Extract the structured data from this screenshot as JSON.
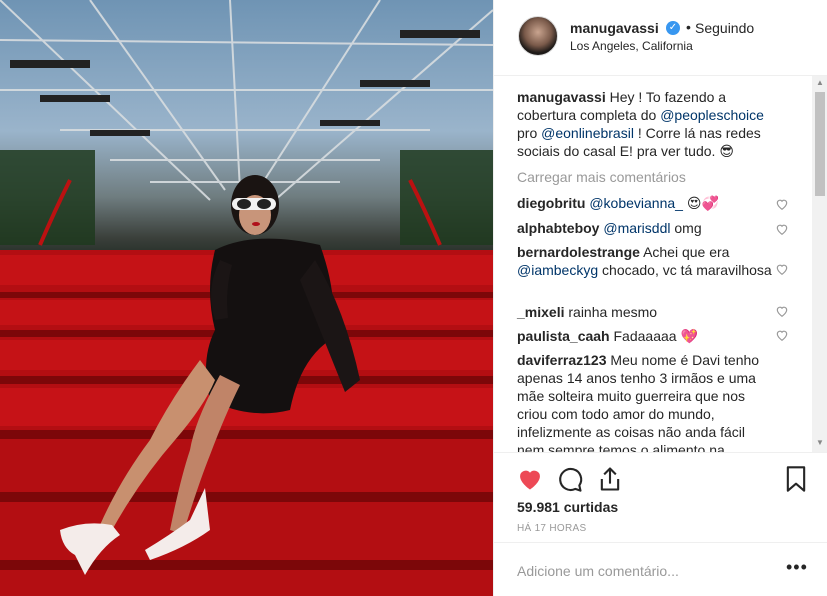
{
  "post": {
    "username": "manugavassi",
    "follow_status": "Seguindo",
    "location": "Los Angeles, California"
  },
  "caption": {
    "username": "manugavassi",
    "text_1": "Hey ! To fazendo a cobertura completa do ",
    "mention_1": "@peopleschoice",
    "text_2": " pro ",
    "mention_2": "@eonlinebrasil",
    "text_3": " ! Corre lá nas redes sociais do casal E! pra ver tudo. 😎"
  },
  "load_more": "Carregar mais comentários",
  "comments": [
    {
      "user": "diegobritu",
      "mention": "@kobevianna_",
      "text": " 😍💞"
    },
    {
      "user": "alphabteboy",
      "mention": "@marisddl",
      "text": " omg"
    },
    {
      "user": "bernardolestrange",
      "text_pre": "Achei que era ",
      "mention": "@iambeckyg",
      "text": " chocado, vc tá maravilhosa"
    },
    {
      "user": "_mixeli",
      "text": "rainha mesmo"
    },
    {
      "user": "paulista_caah",
      "text": "Fadaaaaa 💖"
    },
    {
      "user": "daviferraz123",
      "text": "Meu nome é Davi tenho apenas 14 anos tenho 3 irmãos e uma mãe solteira muito guerreira que nos criou com todo amor do mundo, infelizmente as coisas não anda fácil nem sempre temos o alimento na"
    }
  ],
  "likes": "59.981 curtidas",
  "timestamp": "HÁ 17 HORAS",
  "add_comment_placeholder": "Adicione um comentário...",
  "more_options": "•••",
  "colors": {
    "like_red": "#ed4956",
    "link": "#003569",
    "verified": "#3897f0"
  },
  "icons": [
    "verified-badge-icon",
    "heart-icon",
    "comment-icon",
    "share-icon",
    "bookmark-icon",
    "more-options-icon"
  ]
}
